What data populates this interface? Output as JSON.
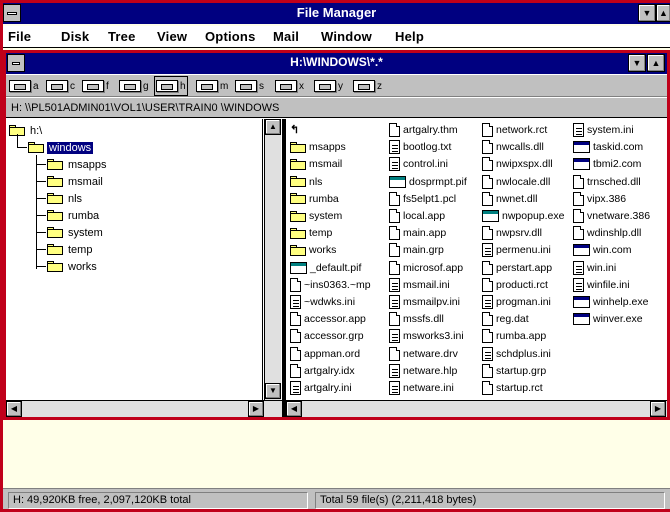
{
  "app": {
    "title": "File Manager"
  },
  "menu": {
    "file": "File",
    "disk": "Disk",
    "tree": "Tree",
    "view": "View",
    "options": "Options",
    "mail": "Mail",
    "window": "Window",
    "help": "Help"
  },
  "child": {
    "title": "H:\\WINDOWS\\*.*"
  },
  "drives": [
    "a",
    "c",
    "f",
    "g",
    "h",
    "m",
    "s",
    "x",
    "y",
    "z"
  ],
  "selected_drive": "h",
  "path": "H: \\\\PL501ADMIN01\\VOL1\\USER\\TRAIN0  \\WINDOWS",
  "tree": {
    "root": "h:\\",
    "selected": "windows",
    "children": [
      "msapps",
      "msmail",
      "nls",
      "rumba",
      "system",
      "temp",
      "works"
    ]
  },
  "files": {
    "col1": [
      {
        "name": "",
        "icon": "up-icon"
      },
      {
        "name": "msapps",
        "icon": "folder"
      },
      {
        "name": "msmail",
        "icon": "folder"
      },
      {
        "name": "nls",
        "icon": "folder"
      },
      {
        "name": "rumba",
        "icon": "folder"
      },
      {
        "name": "system",
        "icon": "folder"
      },
      {
        "name": "temp",
        "icon": "folder"
      },
      {
        "name": "works",
        "icon": "folder"
      },
      {
        "name": "_default.pif",
        "icon": "pif"
      },
      {
        "name": "~ins0363.~mp",
        "icon": "doc"
      },
      {
        "name": "~wdwks.ini",
        "icon": "txt"
      },
      {
        "name": "accessor.app",
        "icon": "doc"
      },
      {
        "name": "accessor.grp",
        "icon": "doc"
      },
      {
        "name": "appman.ord",
        "icon": "doc"
      },
      {
        "name": "artgalry.idx",
        "icon": "doc"
      },
      {
        "name": "artgalry.ini",
        "icon": "txt"
      }
    ],
    "col2": [
      {
        "name": "artgalry.thm",
        "icon": "doc"
      },
      {
        "name": "bootlog.txt",
        "icon": "txt"
      },
      {
        "name": "control.ini",
        "icon": "txt"
      },
      {
        "name": "dosprmpt.pif",
        "icon": "pif"
      },
      {
        "name": "fs5elpt1.pcl",
        "icon": "doc"
      },
      {
        "name": "local.app",
        "icon": "doc"
      },
      {
        "name": "main.app",
        "icon": "doc"
      },
      {
        "name": "main.grp",
        "icon": "doc"
      },
      {
        "name": "microsof.app",
        "icon": "doc"
      },
      {
        "name": "msmail.ini",
        "icon": "txt"
      },
      {
        "name": "msmailpv.ini",
        "icon": "txt"
      },
      {
        "name": "mssfs.dll",
        "icon": "doc"
      },
      {
        "name": "msworks3.ini",
        "icon": "txt"
      },
      {
        "name": "netware.drv",
        "icon": "doc"
      },
      {
        "name": "netware.hlp",
        "icon": "txt"
      },
      {
        "name": "netware.ini",
        "icon": "txt"
      }
    ],
    "col3": [
      {
        "name": "network.rct",
        "icon": "doc"
      },
      {
        "name": "nwcalls.dll",
        "icon": "doc"
      },
      {
        "name": "nwipxspx.dll",
        "icon": "doc"
      },
      {
        "name": "nwlocale.dll",
        "icon": "doc"
      },
      {
        "name": "nwnet.dll",
        "icon": "doc"
      },
      {
        "name": "nwpopup.exe",
        "icon": "pif"
      },
      {
        "name": "nwpsrv.dll",
        "icon": "doc"
      },
      {
        "name": "permenu.ini",
        "icon": "txt"
      },
      {
        "name": "perstart.app",
        "icon": "doc"
      },
      {
        "name": "producti.rct",
        "icon": "doc"
      },
      {
        "name": "progman.ini",
        "icon": "txt"
      },
      {
        "name": "reg.dat",
        "icon": "doc"
      },
      {
        "name": "rumba.app",
        "icon": "doc"
      },
      {
        "name": "schdplus.ini",
        "icon": "txt"
      },
      {
        "name": "startup.grp",
        "icon": "doc"
      },
      {
        "name": "startup.rct",
        "icon": "doc"
      }
    ],
    "col4": [
      {
        "name": "system.ini",
        "icon": "txt"
      },
      {
        "name": "taskid.com",
        "icon": "exe"
      },
      {
        "name": "tbmi2.com",
        "icon": "exe"
      },
      {
        "name": "trnsched.dll",
        "icon": "doc"
      },
      {
        "name": "vipx.386",
        "icon": "doc"
      },
      {
        "name": "vnetware.386",
        "icon": "doc"
      },
      {
        "name": "wdinshlp.dll",
        "icon": "doc"
      },
      {
        "name": "win.com",
        "icon": "exe"
      },
      {
        "name": "win.ini",
        "icon": "txt"
      },
      {
        "name": "winfile.ini",
        "icon": "txt"
      },
      {
        "name": "winhelp.exe",
        "icon": "exe"
      },
      {
        "name": "winver.exe",
        "icon": "exe"
      }
    ]
  },
  "status": {
    "free": "H: 49,920KB free,  2,097,120KB total",
    "total": "Total 59 file(s) (2,211,418 bytes)"
  }
}
